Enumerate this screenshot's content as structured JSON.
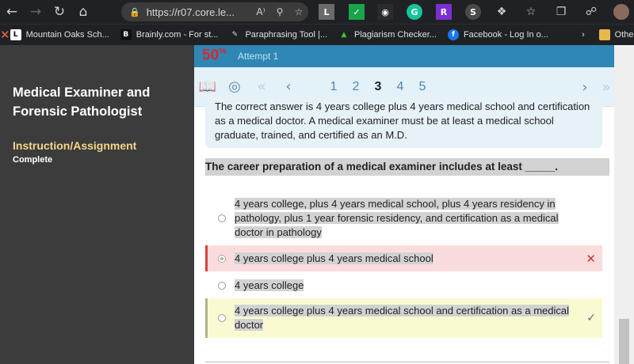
{
  "browser": {
    "url": "https://r07.core.le...",
    "read_aloud": "A⁾",
    "bookmarks": [
      {
        "label": "Mountain Oaks Sch...",
        "icon": "L",
        "color": "#ffffff",
        "text_color": "#000"
      },
      {
        "label": "Brainly.com - For st...",
        "icon": "B",
        "color": "#111111",
        "text_color": "#fff"
      },
      {
        "label": "Paraphrasing Tool |...",
        "icon": "✎",
        "color": "transparent",
        "text_color": "#ddd"
      },
      {
        "label": "Plagiarism Checker...",
        "icon": "▲",
        "color": "transparent",
        "text_color": "#3fbf3f"
      },
      {
        "label": "Facebook - Log In o...",
        "icon": "f",
        "color": "#1877f2",
        "text_color": "#fff"
      }
    ],
    "other_label": "Other"
  },
  "course": {
    "title": "Medical Examiner and Forensic Pathologist",
    "subtitle": "Instruction/Assignment",
    "status": "Complete"
  },
  "quiz": {
    "score": "50",
    "score_unit": "%",
    "attempt": "Attempt 1",
    "pages": [
      "1",
      "2",
      "3",
      "4",
      "5"
    ],
    "current_page": "3",
    "feedback": "The correct answer is 4 years college plus 4 years medical school and certification as a medical doctor. A medical examiner must be at least a medical school graduate, trained, and certified as an M.D.",
    "question": "The career preparation of a medical examiner includes at least _____.",
    "options": [
      {
        "text": "4 years college, plus 4 years medical school, plus 4 years residency in pathology, plus 1 year forensic residency, and certification as a medical doctor in pathology"
      },
      {
        "text": "4 years college plus 4 years medical school"
      },
      {
        "text": "4 years college"
      },
      {
        "text": "4 years college plus 4 years medical school and certification as a medical doctor"
      }
    ]
  }
}
